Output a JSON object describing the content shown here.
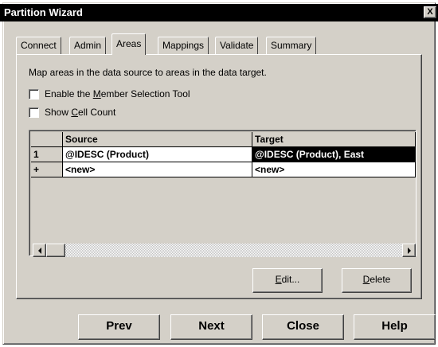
{
  "window": {
    "title": "Partition Wizard",
    "close_glyph": "X"
  },
  "tabs": [
    {
      "label": "Connect",
      "active": false
    },
    {
      "label": "Admin",
      "active": false
    },
    {
      "label": "Areas",
      "active": true
    },
    {
      "label": "Mappings",
      "active": false
    },
    {
      "label": "Validate",
      "active": false
    },
    {
      "label": "Summary",
      "active": false
    }
  ],
  "panel": {
    "description": "Map areas in the data source to areas in the data target.",
    "options": [
      {
        "label_pre": "Enable the ",
        "mnemonic": "M",
        "label_post": "ember Selection Tool",
        "checked": false
      },
      {
        "label_pre": "Show ",
        "mnemonic": "C",
        "label_post": "ell Count",
        "checked": false
      }
    ]
  },
  "grid": {
    "columns": [
      "Source",
      "Target"
    ],
    "rows": [
      {
        "row_header": "1",
        "source": "@IDESC (Product)",
        "target": "@IDESC (Product), East",
        "target_selected": true
      },
      {
        "row_header": "+",
        "source": "<new>",
        "target": "<new>",
        "target_selected": false
      }
    ]
  },
  "panel_buttons": {
    "edit": {
      "mnemonic": "E",
      "rest": "dit..."
    },
    "delete": {
      "mnemonic": "D",
      "rest": "elete"
    }
  },
  "footer_buttons": {
    "prev": "Prev",
    "next": "Next",
    "close": "Close",
    "help": "Help"
  },
  "icons": {
    "close": "close-icon",
    "scroll_left": "scroll-left-arrow-icon",
    "scroll_right": "scroll-right-arrow-icon",
    "checkbox": "checkbox-icon"
  }
}
